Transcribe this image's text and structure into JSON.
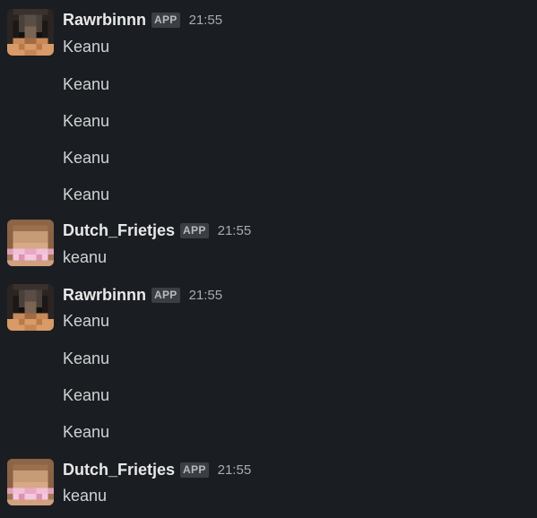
{
  "messages": [
    {
      "username": "Rawrbinnn",
      "badge": "APP",
      "time": "21:55",
      "avatar": "rawrbinnn-avatar",
      "lines": [
        "Keanu",
        "Keanu",
        "Keanu",
        "Keanu",
        "Keanu"
      ]
    },
    {
      "username": "Dutch_Frietjes",
      "badge": "APP",
      "time": "21:55",
      "avatar": "dutch-frietjes-avatar",
      "lines": [
        "keanu"
      ]
    },
    {
      "username": "Rawrbinnn",
      "badge": "APP",
      "time": "21:55",
      "avatar": "rawrbinnn-avatar",
      "lines": [
        "Keanu",
        "Keanu",
        "Keanu",
        "Keanu"
      ]
    },
    {
      "username": "Dutch_Frietjes",
      "badge": "APP",
      "time": "21:55",
      "avatar": "dutch-frietjes-avatar",
      "lines": [
        "keanu"
      ]
    }
  ],
  "colors": {
    "background": "#1a1d21",
    "username": "#e8e8e8",
    "text": "#d1d2d3",
    "timestamp": "#a9abae",
    "badge_bg": "#3b3e43"
  }
}
